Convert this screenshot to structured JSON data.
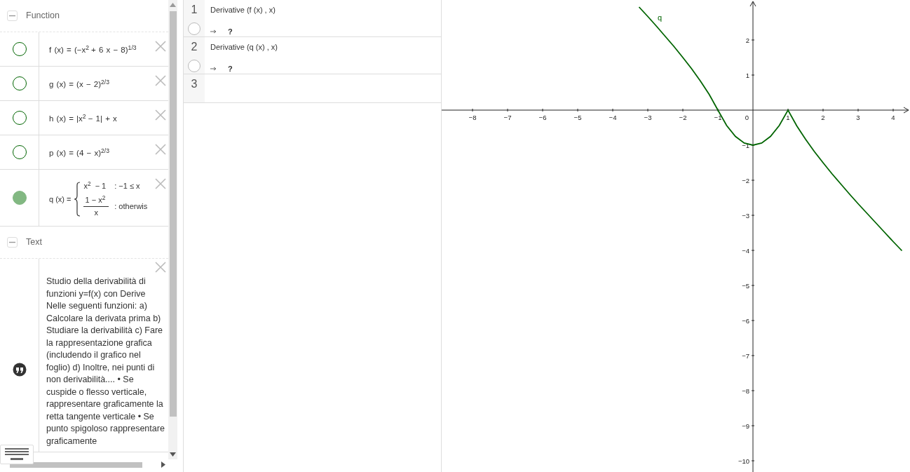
{
  "algebra": {
    "groups": [
      {
        "title": "Function",
        "expanded": true,
        "items": [
          {
            "kind": "formula",
            "formula": "f (x) = (−x$^{2}$ + 6 x − 8)$^{1/3}$",
            "visible": false,
            "color": "#006400"
          },
          {
            "kind": "formula",
            "formula": "g (x) = (x − 2)$^{2/3}$",
            "visible": false,
            "color": "#006400"
          },
          {
            "kind": "formula",
            "formula": "h (x) = |x$^{2}$ − 1| + x",
            "visible": false,
            "color": "#006400"
          },
          {
            "kind": "formula",
            "formula": "p (x) = (4 − x)$^{2/3}$",
            "visible": false,
            "color": "#006400"
          },
          {
            "kind": "piecewise",
            "name": "q (x) =",
            "visible": true,
            "color": "#82b882",
            "cases": [
              {
                "kind": "plain",
                "expr": "x$^{2}$ − 1",
                "condition": ": −1 ≤ x"
              },
              {
                "kind": "fraction",
                "num": "1 − x$^{2}$",
                "den": "x",
                "condition": ": otherwis"
              }
            ]
          }
        ]
      },
      {
        "title": "Text",
        "expanded": true,
        "items": [
          {
            "kind": "text",
            "text": "Studio della derivabilità di funzioni y=f(x) con Derive Nelle seguenti funzioni: a) Calcolare la derivata prima b) Studiare la derivabilità c) Fare la rappresentazione grafica (includendo il grafico nel foglio) d) Inoltre, nei punti di non derivabilità.... • Se cuspide o flesso verticale, rappresentare graficamente la retta tangente verticale • Se punto spigoloso rappresentare graficamente"
          }
        ]
      }
    ]
  },
  "cas": {
    "rows": [
      {
        "number": "1",
        "input": "Derivative (f (x) , x)",
        "output": "?",
        "visible": false
      },
      {
        "number": "2",
        "input": "Derivative (q (x) , x)",
        "output": "?",
        "visible": false
      },
      {
        "number": "3"
      }
    ]
  },
  "graphics": {
    "chart_data": {
      "type": "line",
      "xlim": [
        -8.88,
        4.48
      ],
      "ylim": [
        -10.32,
        3.14
      ],
      "xticks": [
        {
          "value": -8,
          "label": "−8"
        },
        {
          "value": -7,
          "label": "−7"
        },
        {
          "value": -6,
          "label": "−6"
        },
        {
          "value": -5,
          "label": "−5"
        },
        {
          "value": -4,
          "label": "−4"
        },
        {
          "value": -3,
          "label": "−3"
        },
        {
          "value": -2,
          "label": "−2"
        },
        {
          "value": -1,
          "label": "−1"
        },
        1,
        2,
        3,
        4
      ],
      "yticks": [
        2,
        1,
        {
          "value": -1,
          "label": "−1"
        },
        {
          "value": -2,
          "label": "−2"
        },
        {
          "value": -3,
          "label": "−3"
        },
        {
          "value": -4,
          "label": "−4"
        },
        {
          "value": -5,
          "label": "−5"
        },
        {
          "value": -6,
          "label": "−6"
        },
        {
          "value": -7,
          "label": "−7"
        },
        {
          "value": -8,
          "label": "−8"
        },
        {
          "value": -9,
          "label": "−9"
        },
        {
          "value": -10,
          "label": "−10"
        }
      ],
      "x": [
        -3.25,
        -3,
        -2.75,
        -2.5,
        -2.25,
        -2,
        -1.75,
        -1.5,
        -1.25,
        -1,
        -0.75,
        -0.5,
        -0.25,
        0,
        0.25,
        0.5,
        0.75,
        1,
        1.25,
        1.5,
        1.75,
        2,
        2.25,
        2.5,
        2.75,
        3,
        3.25,
        3.5,
        3.75,
        4,
        4.25
      ],
      "series": [
        {
          "name": "q",
          "color": "#006400",
          "values": [
            2.94,
            2.67,
            2.39,
            2.1,
            1.81,
            1.5,
            1.18,
            0.83,
            0.45,
            0,
            -0.44,
            -0.75,
            -0.94,
            -1,
            -0.94,
            -0.75,
            -0.44,
            0,
            -0.45,
            -0.83,
            -1.18,
            -1.5,
            -1.81,
            -2.1,
            -2.39,
            -2.67,
            -2.94,
            -3.21,
            -3.48,
            -3.75,
            -4.01
          ]
        }
      ]
    },
    "origin_label": "0"
  }
}
